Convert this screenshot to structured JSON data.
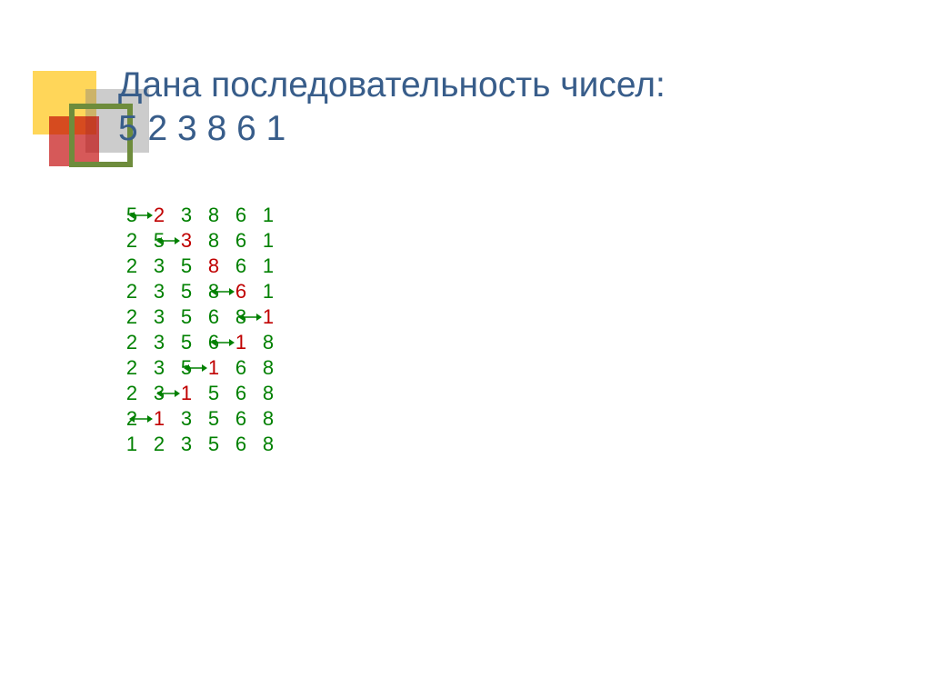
{
  "title": {
    "line1": "Дана последовательность чисел:",
    "line2": "5  2  3  8  6  1"
  },
  "rows": [
    [
      {
        "t": "5",
        "c": "g"
      },
      {
        "arrow": true
      },
      {
        "t": "2",
        "c": "r"
      },
      {
        "t": "3",
        "c": "g"
      },
      {
        "t": "8",
        "c": "g"
      },
      {
        "t": "6",
        "c": "g"
      },
      {
        "t": "1",
        "c": "g"
      }
    ],
    [
      {
        "t": "2",
        "c": "g"
      },
      {
        "t": "5",
        "c": "g"
      },
      {
        "arrow": true
      },
      {
        "t": "3",
        "c": "r"
      },
      {
        "t": "8",
        "c": "g"
      },
      {
        "t": "6",
        "c": "g"
      },
      {
        "t": "1",
        "c": "g"
      }
    ],
    [
      {
        "t": "2",
        "c": "g"
      },
      {
        "t": "3",
        "c": "g"
      },
      {
        "t": "5",
        "c": "g"
      },
      {
        "t": "8",
        "c": "r"
      },
      {
        "t": "6",
        "c": "g"
      },
      {
        "t": "1",
        "c": "g"
      }
    ],
    [
      {
        "t": "2",
        "c": "g"
      },
      {
        "t": "3",
        "c": "g"
      },
      {
        "t": "5",
        "c": "g"
      },
      {
        "t": "8",
        "c": "g"
      },
      {
        "arrow": true
      },
      {
        "t": "6",
        "c": "r"
      },
      {
        "t": "1",
        "c": "g"
      }
    ],
    [
      {
        "t": "2",
        "c": "g"
      },
      {
        "t": "3",
        "c": "g"
      },
      {
        "t": "5",
        "c": "g"
      },
      {
        "t": "6",
        "c": "g"
      },
      {
        "t": "8",
        "c": "g"
      },
      {
        "arrow": true
      },
      {
        "t": "1",
        "c": "r"
      }
    ],
    [
      {
        "t": "2",
        "c": "g"
      },
      {
        "t": "3",
        "c": "g"
      },
      {
        "t": "5",
        "c": "g"
      },
      {
        "t": "6",
        "c": "g"
      },
      {
        "arrow": true
      },
      {
        "t": "1",
        "c": "r"
      },
      {
        "t": "8",
        "c": "g"
      }
    ],
    [
      {
        "t": "2",
        "c": "g"
      },
      {
        "t": "3",
        "c": "g"
      },
      {
        "t": "5",
        "c": "g"
      },
      {
        "arrow": true
      },
      {
        "t": "1",
        "c": "r"
      },
      {
        "t": "6",
        "c": "g"
      },
      {
        "t": "8",
        "c": "g"
      }
    ],
    [
      {
        "t": "2",
        "c": "g"
      },
      {
        "t": "3",
        "c": "g"
      },
      {
        "arrow": true
      },
      {
        "t": "1",
        "c": "r"
      },
      {
        "t": "5",
        "c": "g"
      },
      {
        "t": "6",
        "c": "g"
      },
      {
        "t": "8",
        "c": "g"
      }
    ],
    [
      {
        "t": "2",
        "c": "g"
      },
      {
        "arrow": true
      },
      {
        "t": "1",
        "c": "r"
      },
      {
        "t": "3",
        "c": "g"
      },
      {
        "t": "5",
        "c": "g"
      },
      {
        "t": "6",
        "c": "g"
      },
      {
        "t": "8",
        "c": "g"
      }
    ],
    [
      {
        "t": "1",
        "c": "g"
      },
      {
        "t": "2",
        "c": "g"
      },
      {
        "t": "3",
        "c": "g"
      },
      {
        "t": "5",
        "c": "g"
      },
      {
        "t": "6",
        "c": "g"
      },
      {
        "t": "8",
        "c": "g"
      }
    ]
  ]
}
